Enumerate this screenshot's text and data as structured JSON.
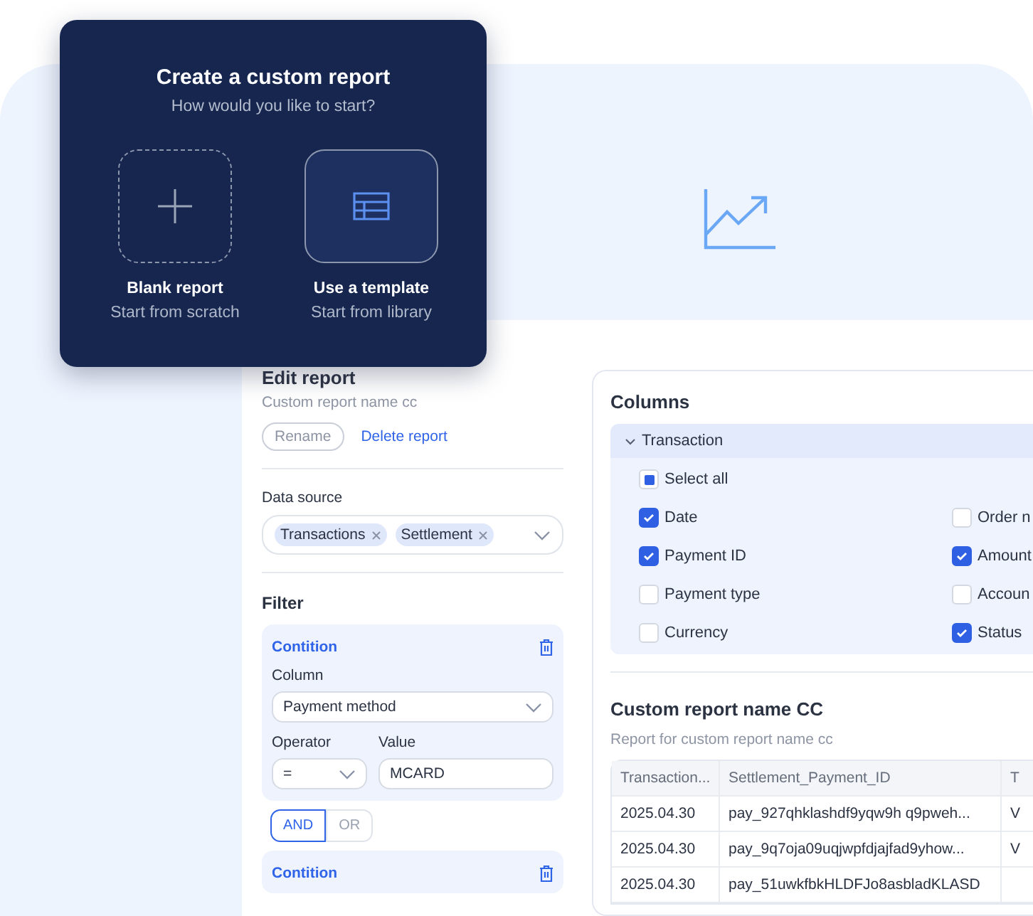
{
  "dialog": {
    "title": "Create a custom report",
    "subtitle": "How would you like to start?",
    "options": [
      {
        "kind": "blank",
        "title": "Blank report",
        "subtitle": "Start from scratch",
        "selected": false
      },
      {
        "kind": "template",
        "title": "Use a template",
        "subtitle": "Start from library",
        "selected": true
      }
    ]
  },
  "edit_report": {
    "title": "Edit report",
    "report_name": "Custom report name cc",
    "rename_button": "Rename",
    "delete_link": "Delete report",
    "data_source": {
      "label": "Data source",
      "tags": [
        "Transactions",
        "Settlement"
      ]
    },
    "filter": {
      "title": "Filter",
      "conditions": [
        {
          "title": "Contition",
          "column_label": "Column",
          "column_value": "Payment method",
          "operator_label": "Operator",
          "operator_value": "=",
          "value_label": "Value",
          "value": "MCARD"
        },
        {
          "title": "Contition"
        }
      ],
      "logic": [
        {
          "label": "AND",
          "selected": true
        },
        {
          "label": "OR",
          "selected": false
        }
      ]
    }
  },
  "columns_panel": {
    "title": "Columns",
    "group": {
      "label": "Transaction",
      "expanded": true,
      "select_all": {
        "label": "Select all",
        "indeterminate": true
      },
      "items": [
        {
          "label": "Date",
          "checked": true
        },
        {
          "label": "Order n",
          "checked": false
        },
        {
          "label": "Payment ID",
          "checked": true
        },
        {
          "label": "Amount",
          "checked": true
        },
        {
          "label": "Payment type",
          "checked": false
        },
        {
          "label": "Accoun",
          "checked": false
        },
        {
          "label": "Currency",
          "checked": false
        },
        {
          "label": "Status",
          "checked": true
        }
      ]
    }
  },
  "report": {
    "title": "Custom report name CC",
    "subtitle": "Report for custom report name cc",
    "table": {
      "columns": [
        "Transaction...",
        "Settlement_Payment_ID",
        "T"
      ],
      "rows": [
        [
          "2025.04.30",
          "pay_927qhklashdf9yqw9h q9pweh...",
          "V"
        ],
        [
          "2025.04.30",
          "pay_9q7oja09uqjwpfdjajfad9yhow...",
          "V"
        ],
        [
          "2025.04.30",
          "pay_51uwkfbkHLDFJo8asbladKLASD"
        ]
      ]
    }
  }
}
